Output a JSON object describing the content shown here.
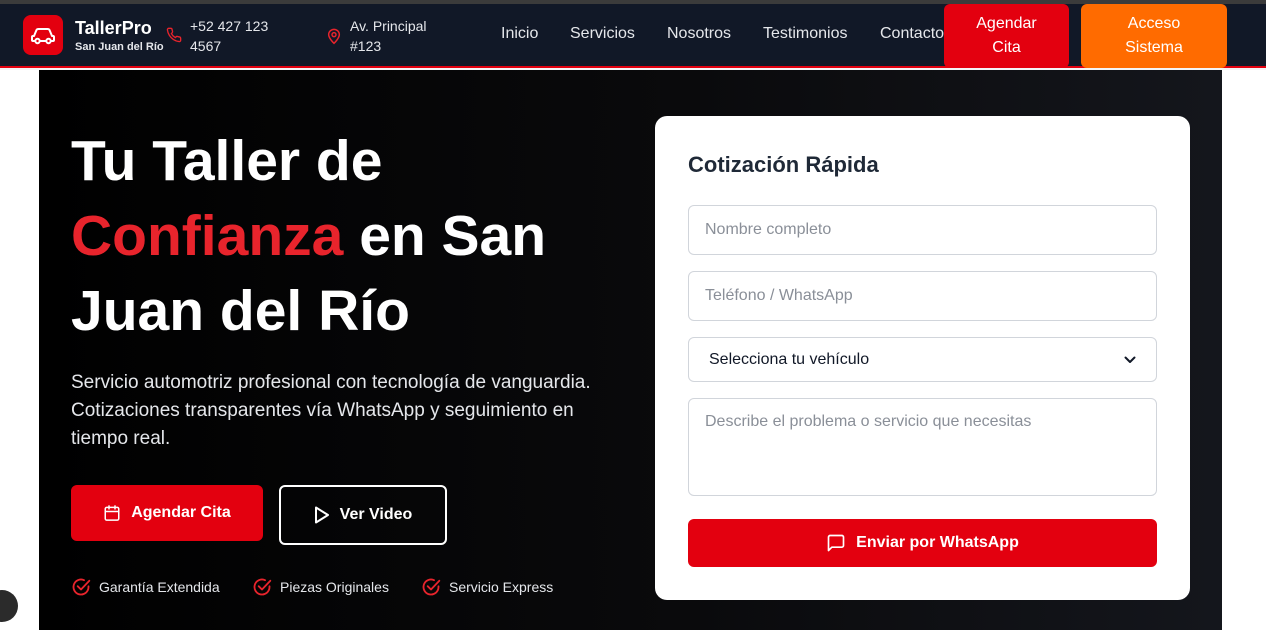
{
  "header": {
    "brand_name": "TallerPro",
    "brand_sub": "San Juan del Río",
    "phone_line1": "+52 427 123",
    "phone_line2": "4567",
    "address_line1": "Av. Principal",
    "address_line2": "#123",
    "nav": [
      "Inicio",
      "Servicios",
      "Nosotros",
      "Testimonios",
      "Contacto"
    ],
    "agendar_line1": "Agendar",
    "agendar_line2": "Cita",
    "acceso_line1": "Acceso",
    "acceso_line2": "Sistema"
  },
  "hero": {
    "title_part1": "Tu Taller de",
    "title_accent": "Confianza",
    "title_part2": "en San Juan del Río",
    "description": "Servicio automotriz profesional con tecnología de vanguardia. Cotizaciones transparentes vía WhatsApp y seguimiento en tiempo real.",
    "btn_agendar": "Agendar Cita",
    "btn_video": "Ver Video",
    "features": [
      "Garantía Extendida",
      "Piezas Originales",
      "Servicio Express"
    ]
  },
  "quote_form": {
    "title": "Cotización Rápida",
    "name_placeholder": "Nombre completo",
    "phone_placeholder": "Teléfono / WhatsApp",
    "vehicle_selected": "Selecciona tu vehículo",
    "problem_placeholder": "Describe el problema o servicio que necesitas",
    "submit_label": "Enviar por WhatsApp"
  },
  "colors": {
    "brand_red": "#e3000f",
    "accent_orange": "#ff6b00",
    "header_bg": "#111827"
  },
  "icons": {
    "logo": "car-icon",
    "phone": "phone-icon",
    "address": "map-pin-icon",
    "agendar": "calendar-icon",
    "video": "play-icon",
    "feature": "check-circle-icon",
    "submit": "chat-icon"
  }
}
